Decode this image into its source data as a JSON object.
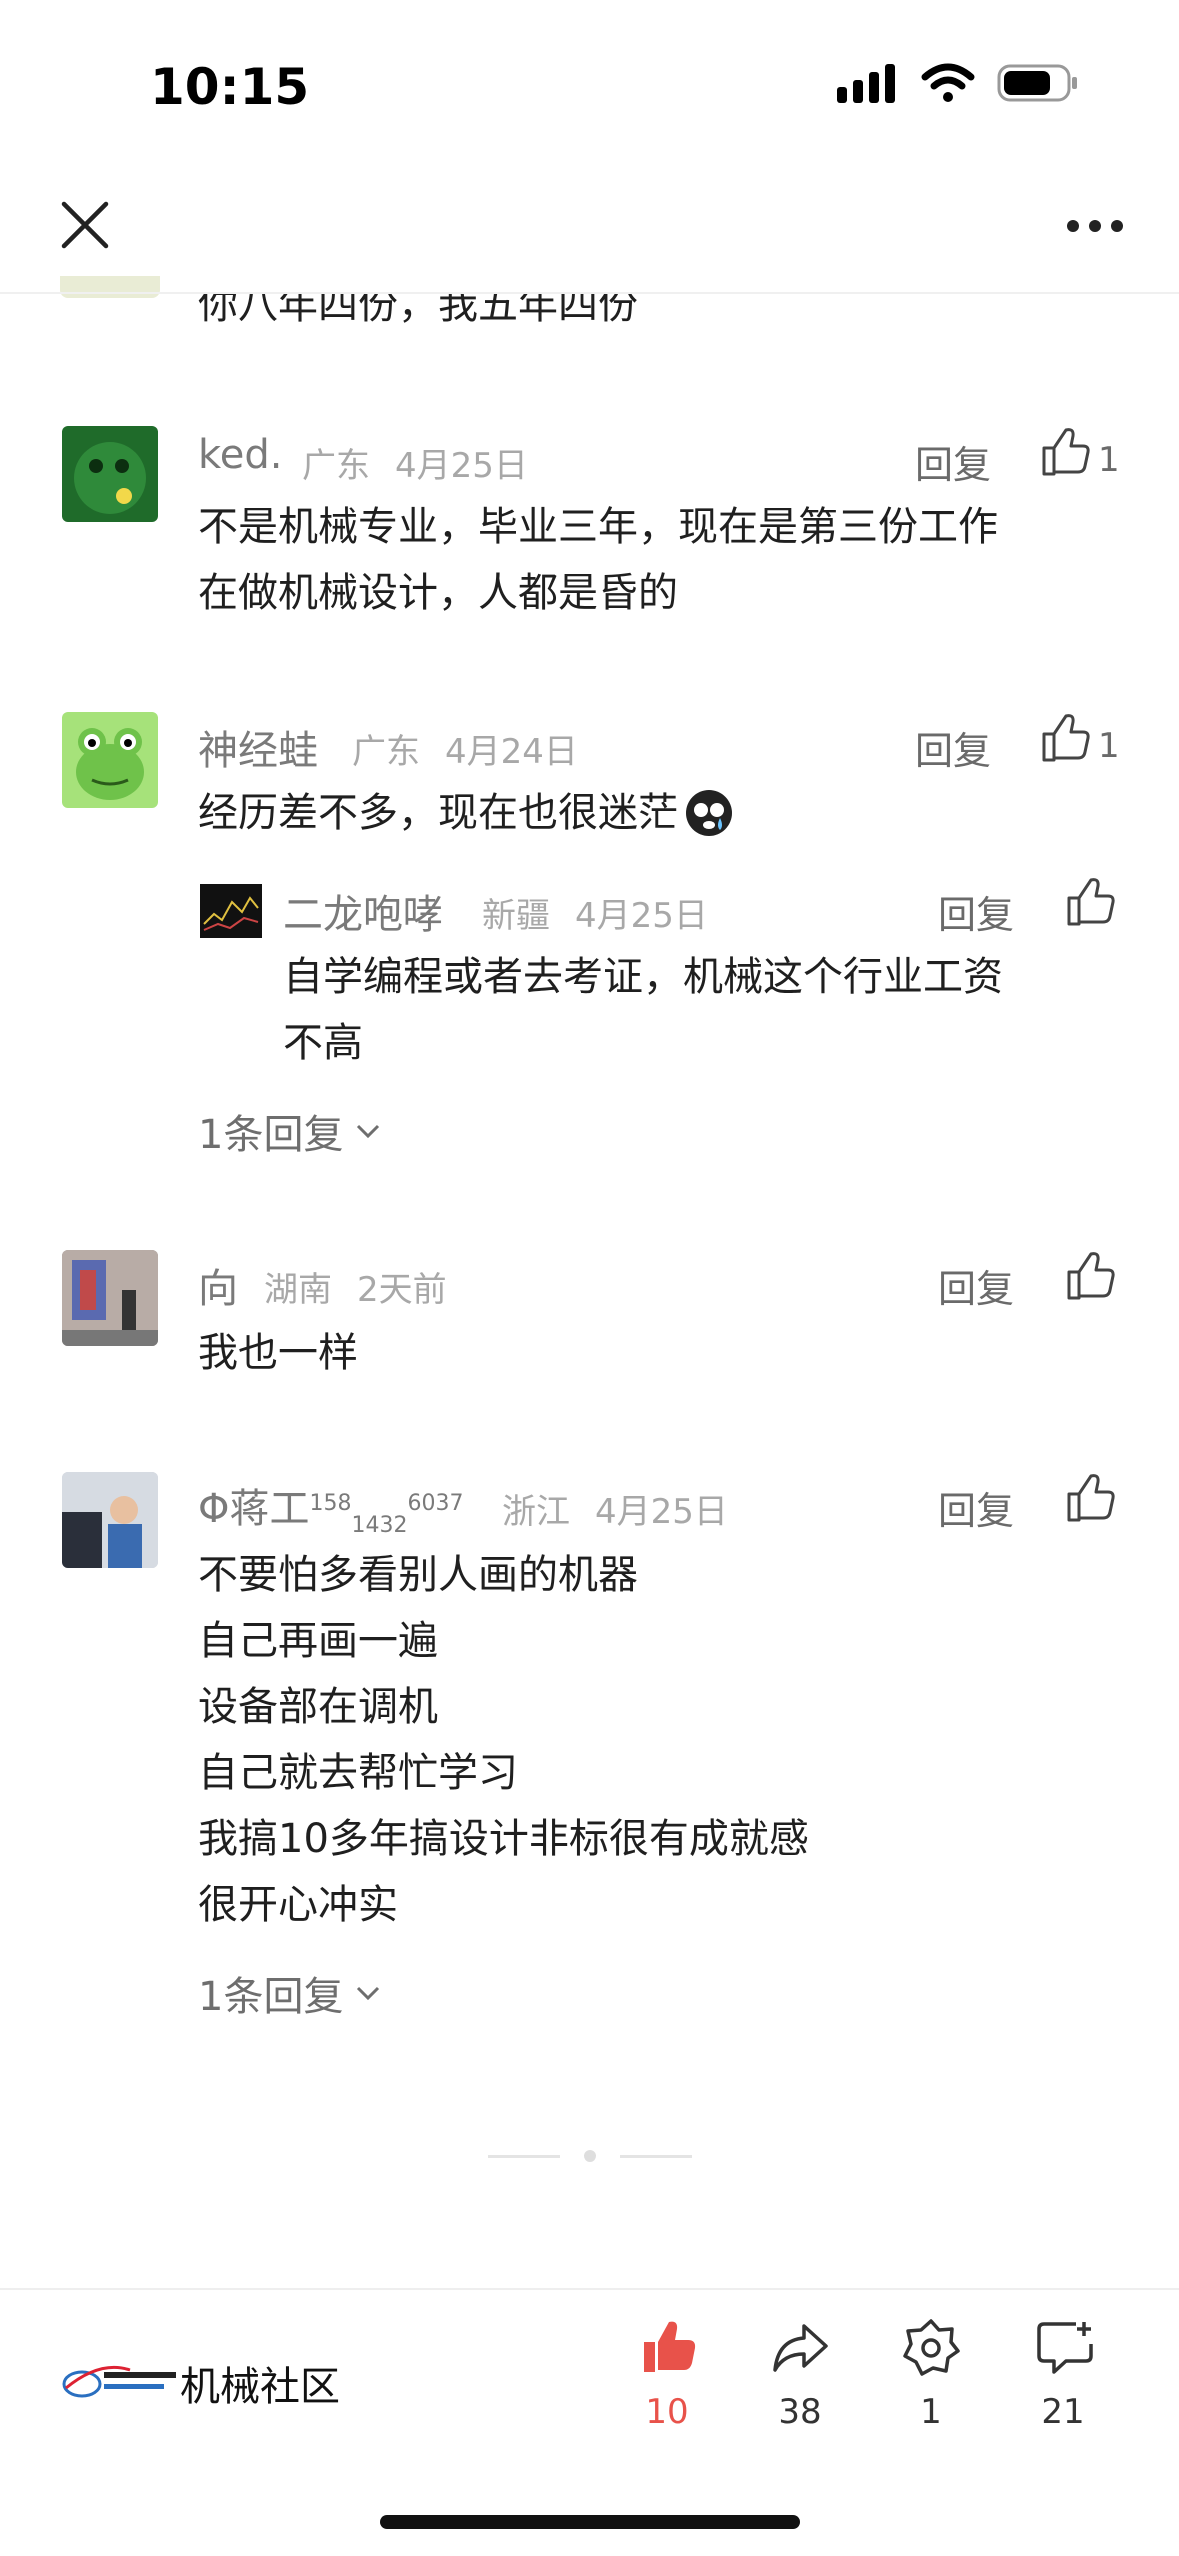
{
  "status": {
    "time": "10:15"
  },
  "partial_comment": {
    "text": "你八年四份，我五年四份"
  },
  "comments": [
    {
      "user": "ked.",
      "region": "广东",
      "date": "4月25日",
      "reply_label": "回复",
      "likes": "1",
      "lines": [
        "不是机械专业，毕业三年，现在是第三份工作",
        "在做机械设计，人都是昏的"
      ],
      "avatar_color": "#1f6b2a"
    },
    {
      "user": "神经蛙",
      "region": "广东",
      "date": "4月24日",
      "reply_label": "回复",
      "likes": "1",
      "lines": [
        "经历差不多，现在也很迷茫"
      ],
      "avatar_color": "#a6e27a",
      "sub_reply": {
        "user": "二龙咆哮",
        "region": "新疆",
        "date": "4月25日",
        "reply_label": "回复",
        "lines": [
          "自学编程或者去考证，机械这个行业工资",
          "不高"
        ]
      },
      "more_replies": "1条回复"
    },
    {
      "user": "向",
      "region": "湖南",
      "date": "2天前",
      "reply_label": "回复",
      "lines": [
        "我也一样"
      ]
    },
    {
      "user": "Φ蒋工",
      "user_sup1": "158",
      "user_sub": "1432",
      "user_sup2": "6037",
      "region": "浙江",
      "date": "4月25日",
      "reply_label": "回复",
      "lines": [
        "不要怕多看别人画的机器",
        "自己再画一遍",
        "设备部在调机",
        "自己就去帮忙学习",
        "我搞10多年搞设计非标很有成就感",
        "很开心冲实"
      ],
      "more_replies": "1条回复"
    }
  ],
  "footer": {
    "community": "机械社区",
    "likes": "10",
    "shares": "38",
    "collects": "1",
    "comments": "21",
    "accent": "#e8524a"
  }
}
